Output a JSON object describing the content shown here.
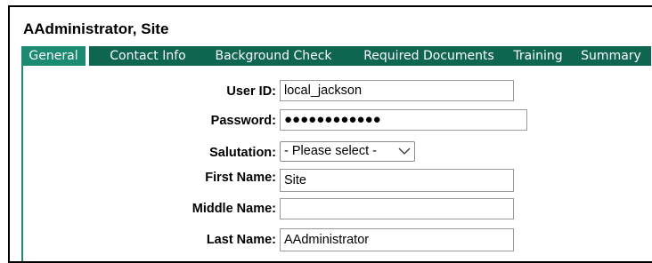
{
  "header": {
    "title": "AAdministrator, Site"
  },
  "tabs": [
    {
      "label": "General",
      "active": true
    },
    {
      "label": "Contact Info",
      "active": false
    },
    {
      "label": "Background Check",
      "active": false
    },
    {
      "label": "Required Documents",
      "active": false
    },
    {
      "label": "Training",
      "active": false
    },
    {
      "label": "Summary",
      "active": false
    }
  ],
  "form": {
    "user_id": {
      "label": "User ID:",
      "value": "local_jackson"
    },
    "password": {
      "label": "Password:",
      "value": "●●●●●●●●●●●●"
    },
    "salutation": {
      "label": "Salutation:",
      "value": "- Please select -",
      "icon": "chevron-down-icon"
    },
    "first_name": {
      "label": "First Name:",
      "value": "Site"
    },
    "middle_name": {
      "label": "Middle Name:",
      "value": ""
    },
    "last_name": {
      "label": "Last Name:",
      "value": "AAdministrator"
    }
  },
  "colors": {
    "tab_background": "#0e6651",
    "tab_active_background": "#1a8a70",
    "tab_text": "#ffffff"
  }
}
